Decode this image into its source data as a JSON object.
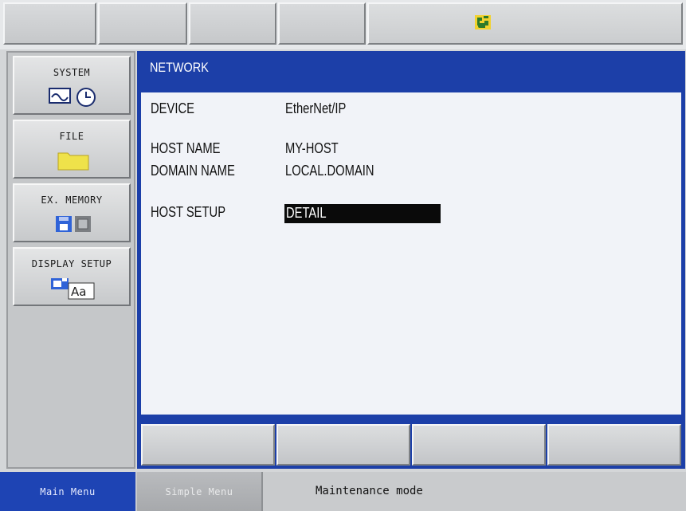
{
  "window": {
    "title": "NETWORK"
  },
  "top_tabs": [
    {
      "label": ""
    },
    {
      "label": ""
    },
    {
      "label": ""
    },
    {
      "label": ""
    },
    {
      "icon": "robot-status-icon"
    }
  ],
  "left_menu": {
    "items": [
      {
        "label": "SYSTEM",
        "icon": "system-clock-icon"
      },
      {
        "label": "FILE",
        "icon": "folder-icon"
      },
      {
        "label": "EX. MEMORY",
        "icon": "memory-device-icon"
      },
      {
        "label": "DISPLAY SETUP",
        "icon": "display-font-icon"
      }
    ]
  },
  "network": {
    "device_label": "DEVICE",
    "device_value": "EtherNet/IP",
    "host_name_label": "HOST NAME",
    "host_name_value": "MY-HOST",
    "domain_name_label": "DOMAIN NAME",
    "domain_name_value": "LOCAL.DOMAIN",
    "host_setup_label": "HOST SETUP",
    "host_setup_value": "DETAIL"
  },
  "bottom_buttons": [
    {
      "label": ""
    },
    {
      "label": ""
    },
    {
      "label": ""
    },
    {
      "label": ""
    }
  ],
  "status_bar": {
    "main_menu": "Main Menu",
    "simple_menu": "Simple Menu",
    "mode": "Maintenance mode"
  },
  "colors": {
    "title_blue": "#1c3fa8",
    "content_bg": "#f1f3f8",
    "selection_bg": "#0a0a0a",
    "main_menu_bg": "#1e44b4"
  }
}
